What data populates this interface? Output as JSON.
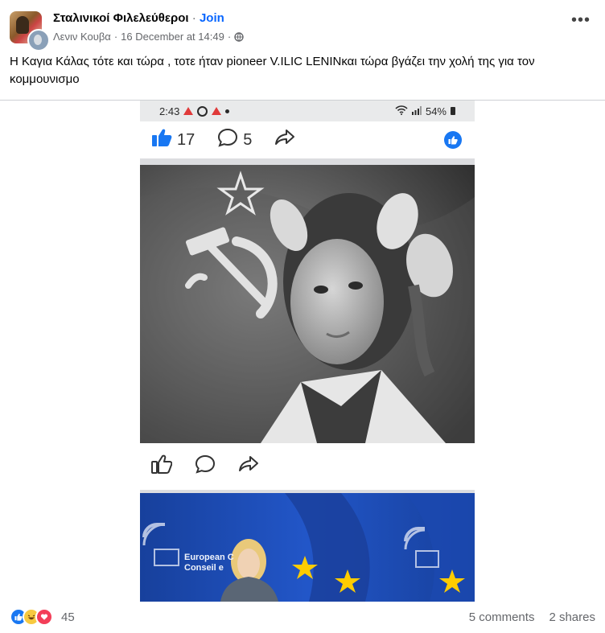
{
  "post": {
    "group_name": "Σταλινικοί Φιλελεύθεροι",
    "separator": " · ",
    "join_label": "Join",
    "author": "Λενιν Κουβα",
    "meta_separator": " · ",
    "timestamp": "16 December at 14:49",
    "meta_separator2": " ·",
    "caption": "Η Καγια Κάλας τότε  και τώρα , τοτε  ήταν  pioneer  V.ILIC LENINκαι τώρα βγάζει  την χολή της για τον κομμουνισμο",
    "more_icon": "more-options-icon"
  },
  "screenshot": {
    "status_time": "2:43",
    "status_battery": "54%",
    "like_count": "17",
    "comment_count": "5",
    "eu_sign_line1": "European C",
    "eu_sign_line2": "Conseil e"
  },
  "footer": {
    "reaction_count": "45",
    "comments": "5 comments",
    "shares": "2 shares"
  },
  "colors": {
    "accent": "#0866ff",
    "muted": "#65676b",
    "like_blue": "#1877f2",
    "eu_blue": "#1c4db0",
    "eu_star": "#ffcc00"
  }
}
